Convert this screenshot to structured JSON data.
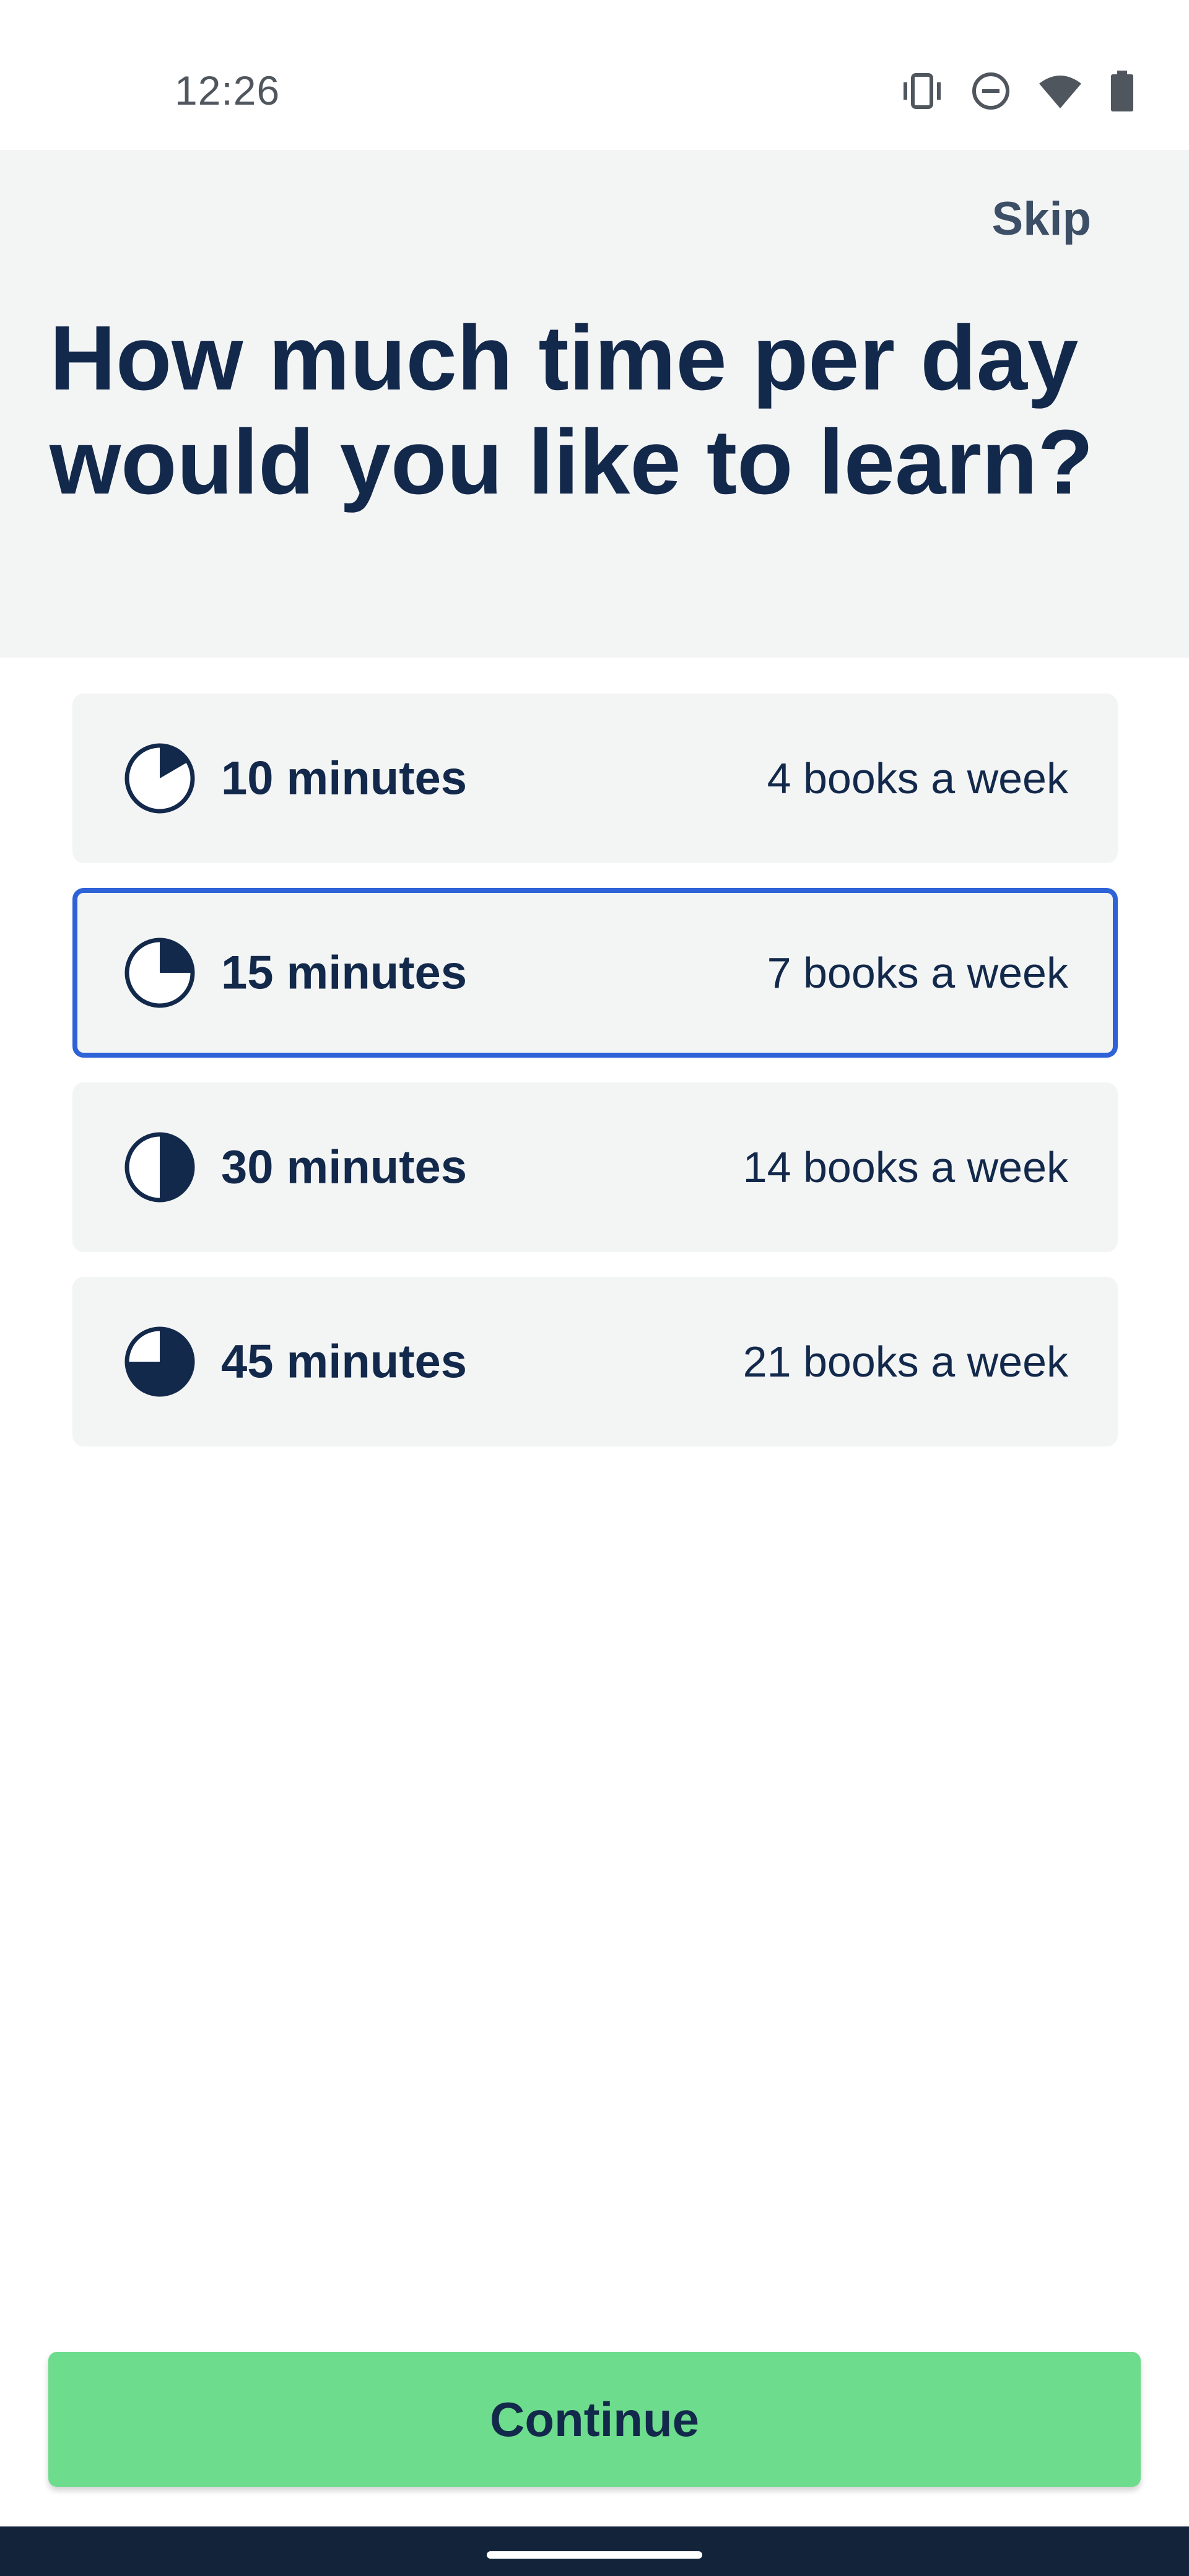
{
  "status_bar": {
    "time": "12:26",
    "icons": [
      "vibrate-icon",
      "do-not-disturb-icon",
      "wifi-icon",
      "battery-icon"
    ]
  },
  "header": {
    "skip_label": "Skip",
    "title_line1": "How much time per day",
    "title_line2": "would you like to learn?"
  },
  "options": [
    {
      "label": "10 minutes",
      "books": "4 books a week",
      "fraction": 0.166,
      "selected": false
    },
    {
      "label": "15 minutes",
      "books": "7 books a week",
      "fraction": 0.25,
      "selected": true
    },
    {
      "label": "30 minutes",
      "books": "14 books a week",
      "fraction": 0.5,
      "selected": false
    },
    {
      "label": "45 minutes",
      "books": "21 books a week",
      "fraction": 0.75,
      "selected": false
    }
  ],
  "continue_label": "Continue",
  "colors": {
    "primary": "#13294b",
    "selected_border": "#2e63d8",
    "continue_bg": "#6ddc8c",
    "card_bg": "#f3f4f4"
  }
}
